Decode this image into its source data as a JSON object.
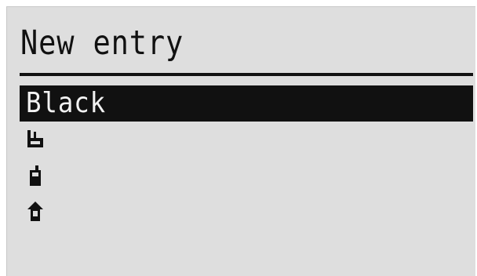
{
  "header": {
    "title": "New entry"
  },
  "list": {
    "items": [
      {
        "label": "Black",
        "selected": true
      },
      {
        "icon": "office-phone-icon",
        "selected": false
      },
      {
        "icon": "mobile-phone-icon",
        "selected": false
      },
      {
        "icon": "home-phone-icon",
        "selected": false
      }
    ]
  },
  "colors": {
    "screen_background": "#dedede",
    "foreground": "#111111",
    "selected_text": "#f2f2f2"
  }
}
